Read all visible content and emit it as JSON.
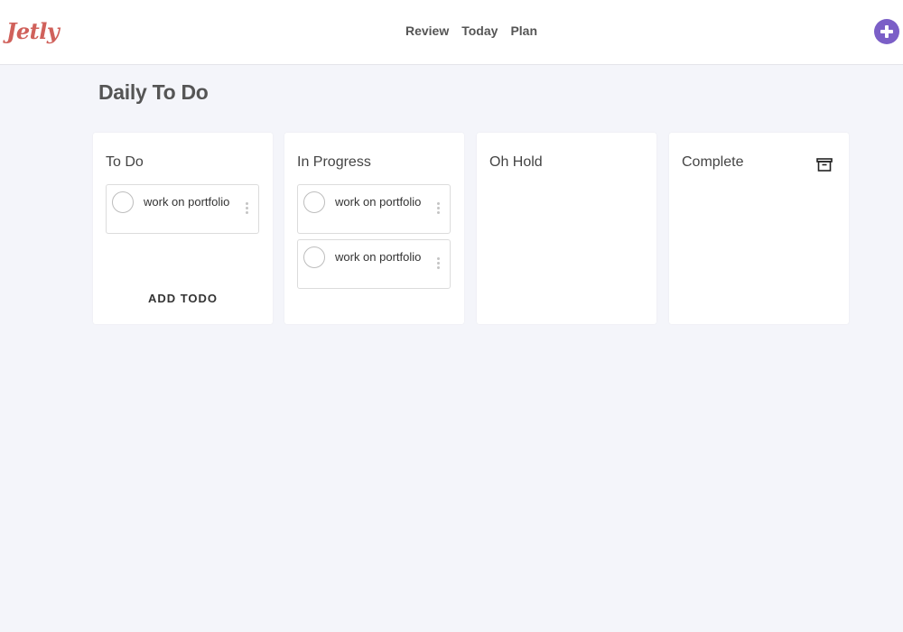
{
  "header": {
    "logo": "Jetly",
    "nav": [
      "Review",
      "Today",
      "Plan"
    ]
  },
  "page": {
    "title": "Daily To Do"
  },
  "columns": [
    {
      "title": "To Do",
      "cards": [
        {
          "text": "work on portfolio"
        }
      ],
      "footer_action": "ADD TODO"
    },
    {
      "title": "In Progress",
      "cards": [
        {
          "text": "work on portfolio"
        },
        {
          "text": "work on portfolio"
        }
      ]
    },
    {
      "title": "Oh Hold",
      "cards": []
    },
    {
      "title": "Complete",
      "cards": [],
      "icon": "archive-icon"
    }
  ],
  "colors": {
    "brand": "#d0615b",
    "accent": "#7b5fc7",
    "background": "#f4f5fa"
  }
}
